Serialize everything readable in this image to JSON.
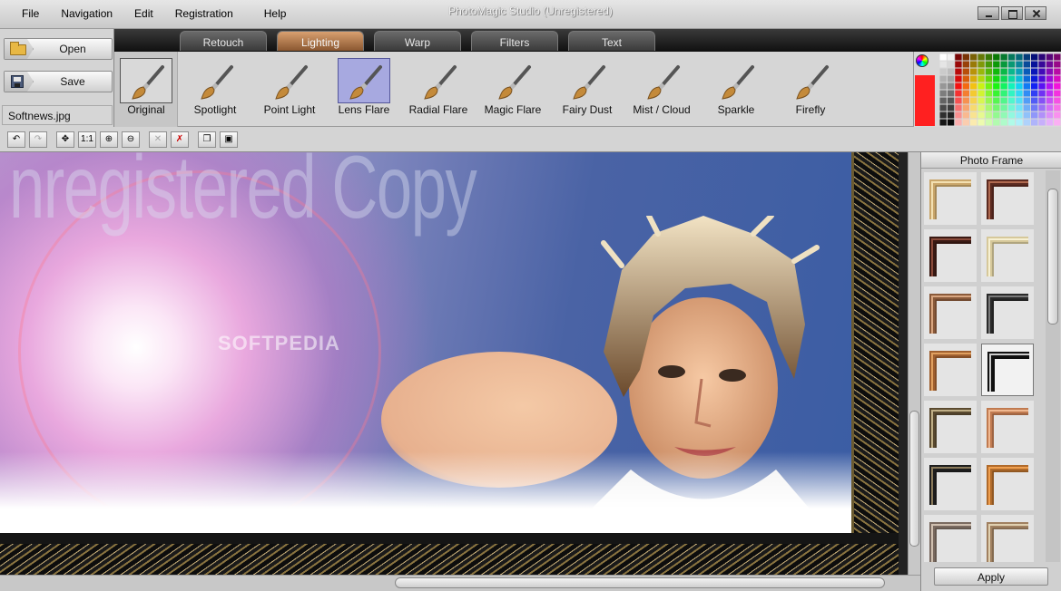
{
  "menu": {
    "file": "File",
    "navigation": "Navigation",
    "edit": "Edit",
    "registration": "Registration",
    "help": "Help"
  },
  "window": {
    "title": "PhotoMagic Studio (Unregistered)"
  },
  "file_panel": {
    "open_label": "Open",
    "save_label": "Save",
    "filename": "Softnews.jpg"
  },
  "tabs": [
    "Retouch",
    "Lighting",
    "Warp",
    "Filters",
    "Text"
  ],
  "active_tab": "Lighting",
  "effects": {
    "original": "Original",
    "items": [
      "Spotlight",
      "Point Light",
      "Lens Flare",
      "Radial Flare",
      "Magic Flare",
      "Fairy Dust",
      "Mist / Cloud",
      "Sparkle",
      "Firefly"
    ],
    "selected": "Lens Flare"
  },
  "palette": {
    "current_color": "#ff2020"
  },
  "toolbar": {
    "zoom_one_to_one": "1:1"
  },
  "canvas": {
    "watermark": "nregistered Copy",
    "softpedia": "SOFTPEDIA"
  },
  "frame_panel": {
    "title": "Photo Frame",
    "apply_label": "Apply"
  },
  "colors": {
    "accent_tab": "#a86f45",
    "selection": "#a7a9e0"
  }
}
